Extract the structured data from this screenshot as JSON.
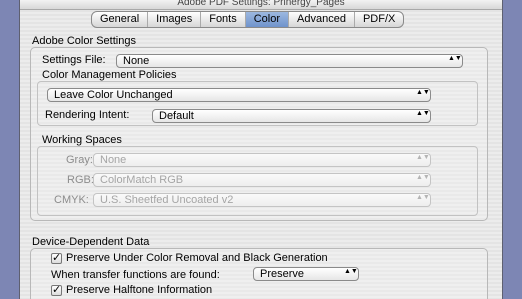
{
  "window": {
    "title": "Adobe PDF Settings: Prinergy_Pages"
  },
  "tabs": [
    {
      "label": "General"
    },
    {
      "label": "Images"
    },
    {
      "label": "Fonts"
    },
    {
      "label": "Color"
    },
    {
      "label": "Advanced"
    },
    {
      "label": "PDF/X"
    }
  ],
  "active_tab": "Color",
  "color_settings": {
    "header": "Adobe Color Settings",
    "settings_file_label": "Settings File:",
    "settings_file_value": "None",
    "policies_header": "Color Management Policies",
    "policy_value": "Leave Color Unchanged",
    "rendering_intent_label": "Rendering Intent:",
    "rendering_intent_value": "Default",
    "working_spaces_header": "Working Spaces",
    "gray_label": "Gray:",
    "gray_value": "None",
    "rgb_label": "RGB:",
    "rgb_value": "ColorMatch RGB",
    "cmyk_label": "CMYK:",
    "cmyk_value": "U.S. Sheetfed Uncoated v2"
  },
  "device_data": {
    "header": "Device-Dependent Data",
    "preserve_ucr_label": "Preserve Under Color Removal and Black Generation",
    "preserve_ucr_checked": true,
    "transfer_label": "When transfer functions are found:",
    "transfer_value": "Preserve",
    "preserve_halftone_label": "Preserve Halftone Information",
    "preserve_halftone_checked": true
  },
  "icons": {
    "check": "✓",
    "popup_arrows": "▲▼"
  }
}
